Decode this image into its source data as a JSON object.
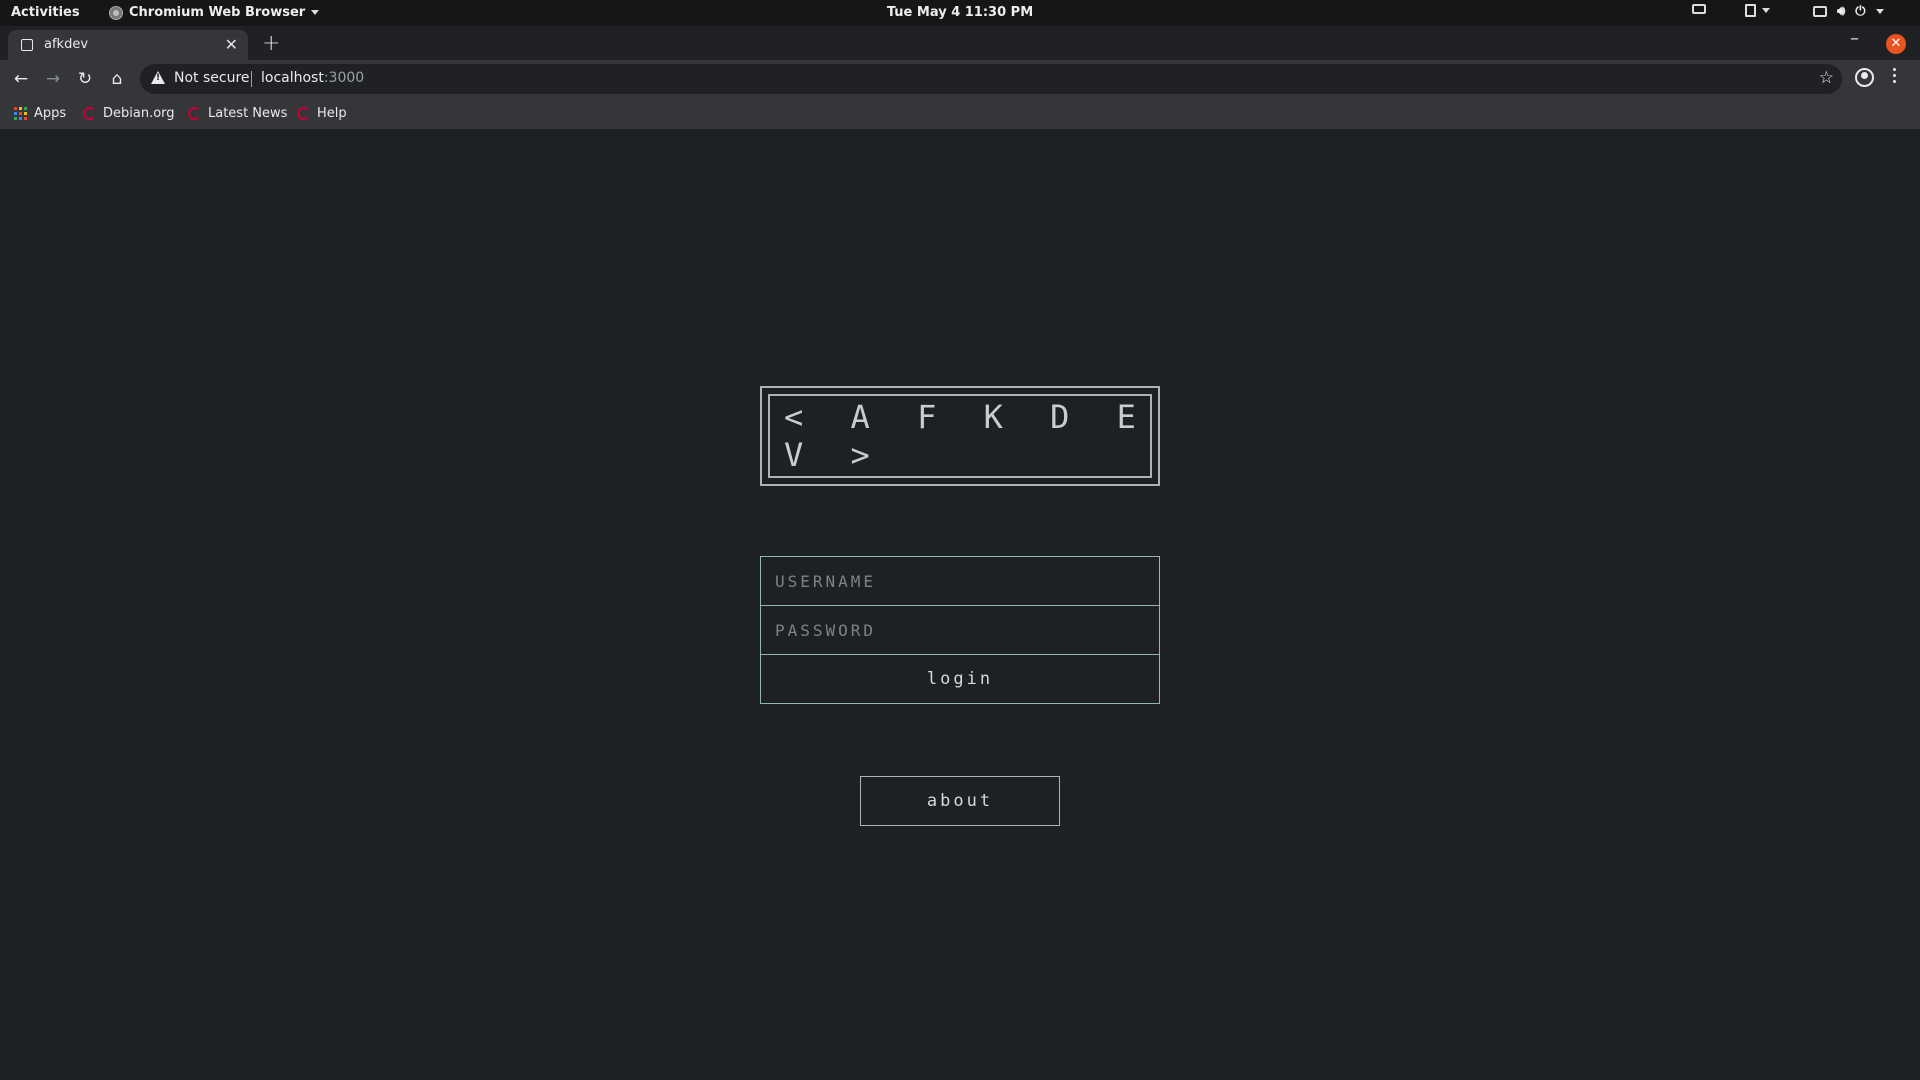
{
  "system_bar": {
    "activities": "Activities",
    "app_name": "Chromium Web Browser",
    "clock": "Tue May 4  11:30 PM"
  },
  "browser": {
    "tab_title": "afkdev",
    "not_secure": "Not secure",
    "url_host": "localhost",
    "url_port": ":3000",
    "bookmarks": [
      "Apps",
      "Debian.org",
      "Latest News",
      "Help"
    ]
  },
  "page": {
    "logo": "< A F K D E V >",
    "username_placeholder": "USERNAME",
    "password_placeholder": "PASSWORD",
    "login_label": "login",
    "about_label": "about"
  },
  "colors": {
    "background": "#1e2124",
    "field_border": "#8fb8b2",
    "logo_border": "#aeb3b7"
  }
}
